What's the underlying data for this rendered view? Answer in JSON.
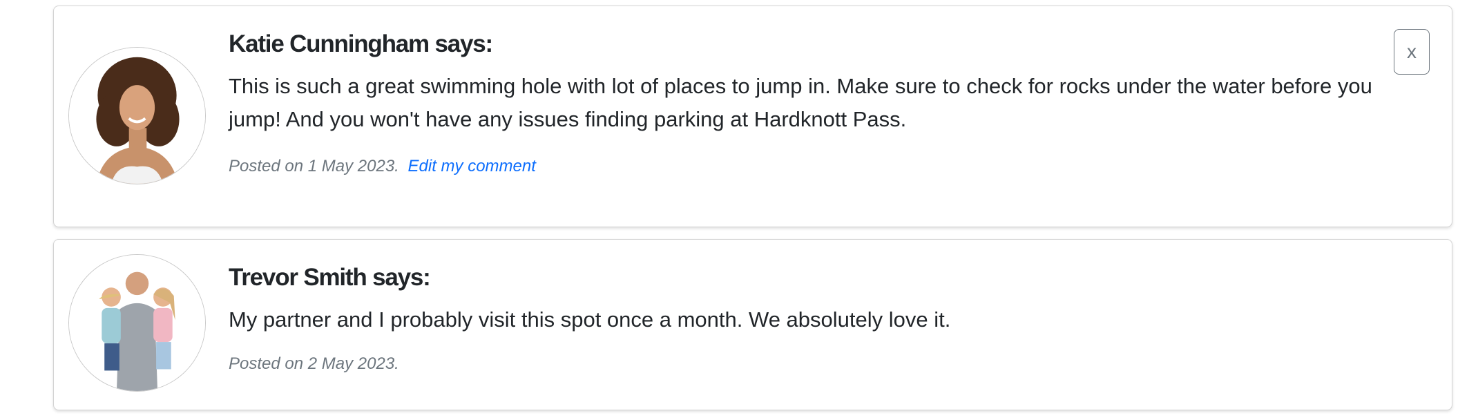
{
  "comments": [
    {
      "author": "Katie Cunningham says:",
      "avatar_icon": "avatar-photo-woman",
      "text": "This is such a great swimming hole with lot of places to jump in. Make sure to check for rocks under the water before you jump! And you won't have any issues finding parking at Hardknott Pass.",
      "posted": "Posted on 1 May 2023.",
      "edit_label": "Edit my comment",
      "close_label": "x"
    },
    {
      "author": "Trevor Smith says:",
      "avatar_icon": "avatar-photo-family",
      "text": "My partner and I probably visit this spot once a month. We absolutely love it.",
      "posted": "Posted on 2 May 2023."
    }
  ],
  "colors": {
    "link": "#0d6efd",
    "muted": "#6c757d",
    "text": "#212529",
    "card_border": "#d3d3d3"
  }
}
